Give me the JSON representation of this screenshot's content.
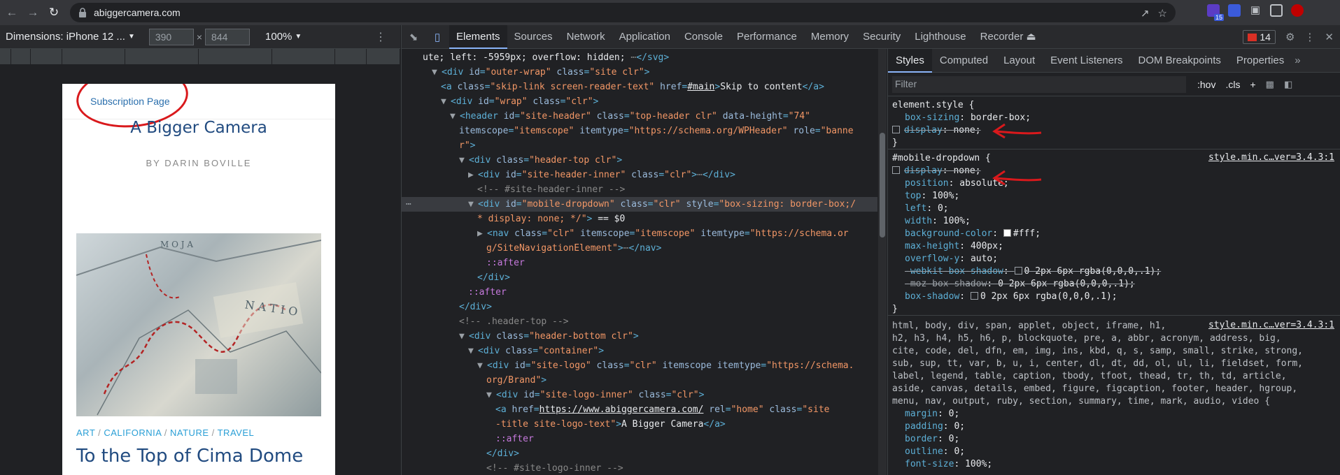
{
  "browser": {
    "url": "abiggercamera.com",
    "ext_badge": "15",
    "extension_colors": [
      "#5b3cc4",
      "#3b5bdb",
      "#bdc1c6",
      "#bdc1c6",
      "#c00000"
    ]
  },
  "device_bar": {
    "dimensions_label": "Dimensions: iPhone 12 ...",
    "width": "390",
    "height": "844",
    "zoom": "100%"
  },
  "page": {
    "subscription_link": "Subscription Page",
    "site_title": "A Bigger Camera",
    "tagline": "BY DARIN BOVILLE",
    "categories": [
      "ART",
      "CALIFORNIA",
      "NATURE",
      "TRAVEL"
    ],
    "category_separator": " / ",
    "post_title": "To the Top of Cima Dome"
  },
  "devtools": {
    "tabs": [
      "Elements",
      "Sources",
      "Network",
      "Application",
      "Console",
      "Performance",
      "Memory",
      "Security",
      "Lighthouse",
      "Recorder ⏏"
    ],
    "issues_count": "14",
    "tree": [
      {
        "segs": [
          [
            "txt",
            "ute; left: -5959px; overflow: hidden; "
          ],
          [
            "cmt",
            "⋯"
          ],
          [
            "tag",
            "</svg>"
          ]
        ],
        "indent": 0
      },
      {
        "segs": [
          [
            "arrow",
            "▼"
          ],
          [
            "tag",
            "<div "
          ],
          [
            "attr",
            "id"
          ],
          [
            "tag",
            "="
          ],
          [
            "val",
            "\"outer-wrap\""
          ],
          [
            "attr",
            " class"
          ],
          [
            "tag",
            "="
          ],
          [
            "val",
            "\"site clr\""
          ],
          [
            "tag",
            ">"
          ]
        ],
        "indent": 1
      },
      {
        "segs": [
          [
            "tag",
            "<a "
          ],
          [
            "attr",
            "class"
          ],
          [
            "tag",
            "="
          ],
          [
            "val",
            "\"skip-link screen-reader-text\""
          ],
          [
            "attr",
            " href"
          ],
          [
            "tag",
            "="
          ],
          [
            "link",
            "#main"
          ],
          [
            "tag",
            ">"
          ],
          [
            "txt",
            "Skip to content"
          ],
          [
            "tag",
            "</a>"
          ]
        ],
        "indent": 2
      },
      {
        "segs": [
          [
            "arrow",
            "▼"
          ],
          [
            "tag",
            "<div "
          ],
          [
            "attr",
            "id"
          ],
          [
            "tag",
            "="
          ],
          [
            "val",
            "\"wrap\""
          ],
          [
            "attr",
            " class"
          ],
          [
            "tag",
            "="
          ],
          [
            "val",
            "\"clr\""
          ],
          [
            "tag",
            ">"
          ]
        ],
        "indent": 2
      },
      {
        "segs": [
          [
            "arrow",
            "▼"
          ],
          [
            "tag",
            "<header "
          ],
          [
            "attr",
            "id"
          ],
          [
            "tag",
            "="
          ],
          [
            "val",
            "\"site-header\""
          ],
          [
            "attr",
            " class"
          ],
          [
            "tag",
            "="
          ],
          [
            "val",
            "\"top-header clr\""
          ],
          [
            "attr",
            " data-height"
          ],
          [
            "tag",
            "="
          ],
          [
            "val",
            "\"74\""
          ]
        ],
        "indent": 3
      },
      {
        "segs": [
          [
            "attr",
            "itemscope"
          ],
          [
            "tag",
            "="
          ],
          [
            "val",
            "\"itemscope\""
          ],
          [
            "attr",
            " itemtype"
          ],
          [
            "tag",
            "="
          ],
          [
            "val",
            "\"https://schema.org/WPHeader\""
          ],
          [
            "attr",
            " role"
          ],
          [
            "tag",
            "="
          ],
          [
            "val",
            "\"banne"
          ]
        ],
        "indent": 4
      },
      {
        "segs": [
          [
            "val",
            "r\""
          ],
          [
            "tag",
            ">"
          ]
        ],
        "indent": 4
      },
      {
        "segs": [
          [
            "arrow",
            "▼"
          ],
          [
            "tag",
            "<div "
          ],
          [
            "attr",
            "class"
          ],
          [
            "tag",
            "="
          ],
          [
            "val",
            "\"header-top clr\""
          ],
          [
            "tag",
            ">"
          ]
        ],
        "indent": 4
      },
      {
        "segs": [
          [
            "arrow",
            "▶"
          ],
          [
            "tag",
            "<div "
          ],
          [
            "attr",
            "id"
          ],
          [
            "tag",
            "="
          ],
          [
            "val",
            "\"site-header-inner\""
          ],
          [
            "attr",
            " class"
          ],
          [
            "tag",
            "="
          ],
          [
            "val",
            "\"clr\""
          ],
          [
            "tag",
            ">"
          ],
          [
            "cmt",
            "⋯"
          ],
          [
            "tag",
            "</div>"
          ]
        ],
        "indent": 5
      },
      {
        "segs": [
          [
            "cmt",
            "<!-- #site-header-inner -->"
          ]
        ],
        "indent": 6
      },
      {
        "segs": [
          [
            "arrow",
            "▼"
          ],
          [
            "tag",
            "<div "
          ],
          [
            "attr",
            "id"
          ],
          [
            "tag",
            "="
          ],
          [
            "val",
            "\"mobile-dropdown\""
          ],
          [
            "attr",
            " class"
          ],
          [
            "tag",
            "="
          ],
          [
            "val",
            "\"clr\""
          ],
          [
            "attr",
            " style"
          ],
          [
            "tag",
            "="
          ],
          [
            "val",
            "\"box-sizing: border-box;/"
          ]
        ],
        "indent": 5,
        "selected": true
      },
      {
        "segs": [
          [
            "val",
            "* display: none; */\""
          ],
          [
            "tag",
            ">"
          ],
          [
            "txt",
            " == $0"
          ]
        ],
        "indent": 6
      },
      {
        "segs": [
          [
            "arrow",
            "▶"
          ],
          [
            "tag",
            "<nav "
          ],
          [
            "attr",
            "class"
          ],
          [
            "tag",
            "="
          ],
          [
            "val",
            "\"clr\""
          ],
          [
            "attr",
            " itemscope"
          ],
          [
            "tag",
            "="
          ],
          [
            "val",
            "\"itemscope\""
          ],
          [
            "attr",
            " itemtype"
          ],
          [
            "tag",
            "="
          ],
          [
            "val",
            "\"https://schema.or"
          ]
        ],
        "indent": 6
      },
      {
        "segs": [
          [
            "val",
            "g/SiteNavigationElement\""
          ],
          [
            "tag",
            ">"
          ],
          [
            "cmt",
            "⋯"
          ],
          [
            "tag",
            "</nav>"
          ]
        ],
        "indent": 7
      },
      {
        "segs": [
          [
            "pseudo",
            "::after"
          ]
        ],
        "indent": 7
      },
      {
        "segs": [
          [
            "tag",
            "</div>"
          ]
        ],
        "indent": 6
      },
      {
        "segs": [
          [
            "pseudo",
            "::after"
          ]
        ],
        "indent": 5
      },
      {
        "segs": [
          [
            "tag",
            "</div>"
          ]
        ],
        "indent": 4
      },
      {
        "segs": [
          [
            "cmt",
            "<!-- .header-top -->"
          ]
        ],
        "indent": 4
      },
      {
        "segs": [
          [
            "arrow",
            "▼"
          ],
          [
            "tag",
            "<div "
          ],
          [
            "attr",
            "class"
          ],
          [
            "tag",
            "="
          ],
          [
            "val",
            "\"header-bottom clr\""
          ],
          [
            "tag",
            ">"
          ]
        ],
        "indent": 4
      },
      {
        "segs": [
          [
            "arrow",
            "▼"
          ],
          [
            "tag",
            "<div "
          ],
          [
            "attr",
            "class"
          ],
          [
            "tag",
            "="
          ],
          [
            "val",
            "\"container\""
          ],
          [
            "tag",
            ">"
          ]
        ],
        "indent": 5
      },
      {
        "segs": [
          [
            "arrow",
            "▼"
          ],
          [
            "tag",
            "<div "
          ],
          [
            "attr",
            "id"
          ],
          [
            "tag",
            "="
          ],
          [
            "val",
            "\"site-logo\""
          ],
          [
            "attr",
            " class"
          ],
          [
            "tag",
            "="
          ],
          [
            "val",
            "\"clr\""
          ],
          [
            "attr",
            " itemscope"
          ],
          [
            "attr",
            " itemtype"
          ],
          [
            "tag",
            "="
          ],
          [
            "val",
            "\"https://schema."
          ]
        ],
        "indent": 6
      },
      {
        "segs": [
          [
            "val",
            "org/Brand\""
          ],
          [
            "tag",
            ">"
          ]
        ],
        "indent": 7
      },
      {
        "segs": [
          [
            "arrow",
            "▼"
          ],
          [
            "tag",
            "<div "
          ],
          [
            "attr",
            "id"
          ],
          [
            "tag",
            "="
          ],
          [
            "val",
            "\"site-logo-inner\""
          ],
          [
            "attr",
            " class"
          ],
          [
            "tag",
            "="
          ],
          [
            "val",
            "\"clr\""
          ],
          [
            "tag",
            ">"
          ]
        ],
        "indent": 7
      },
      {
        "segs": [
          [
            "tag",
            "<a "
          ],
          [
            "attr",
            "href"
          ],
          [
            "tag",
            "="
          ],
          [
            "link",
            "https://www.abiggercamera.com/"
          ],
          [
            "attr",
            " rel"
          ],
          [
            "tag",
            "="
          ],
          [
            "val",
            "\"home\""
          ],
          [
            "attr",
            " class"
          ],
          [
            "tag",
            "="
          ],
          [
            "val",
            "\"site"
          ]
        ],
        "indent": 8
      },
      {
        "segs": [
          [
            "val",
            "-title site-logo-text\""
          ],
          [
            "tag",
            ">"
          ],
          [
            "txt",
            "A Bigger Camera"
          ],
          [
            "tag",
            "</a>"
          ]
        ],
        "indent": 8
      },
      {
        "segs": [
          [
            "pseudo",
            "::after"
          ]
        ],
        "indent": 8
      },
      {
        "segs": [
          [
            "tag",
            "</div>"
          ]
        ],
        "indent": 7
      },
      {
        "segs": [
          [
            "cmt",
            "<!-- #site-logo-inner -->"
          ]
        ],
        "indent": 7
      }
    ],
    "styles_tabs": [
      "Styles",
      "Computed",
      "Layout",
      "Event Listeners",
      "DOM Breakpoints",
      "Properties"
    ],
    "filter_placeholder": "Filter",
    "filter_tools": [
      ":hov",
      ".cls",
      "+"
    ],
    "element_style": {
      "selector": "element.style {",
      "props": [
        {
          "name": "box-sizing",
          "value": "border-box;",
          "checkbox": false,
          "struck": false
        },
        {
          "name": "display",
          "value": "none;",
          "checkbox": true,
          "struck": true
        }
      ]
    },
    "mobile_dropdown": {
      "selector": "#mobile-dropdown {",
      "source": "style.min.c…ver=3.4.3:1",
      "props": [
        {
          "name": "display",
          "value": "none;",
          "checkbox": true,
          "struck": true
        },
        {
          "name": "position",
          "value": "absolute;"
        },
        {
          "name": "top",
          "value": "100%;"
        },
        {
          "name": "left",
          "value": "0;"
        },
        {
          "name": "width",
          "value": "100%;"
        },
        {
          "name": "background-color",
          "value": "#fff;",
          "swatch": "#fff"
        },
        {
          "name": "max-height",
          "value": "400px;"
        },
        {
          "name": "overflow-y",
          "value": "auto;"
        },
        {
          "name": "-webkit-box-shadow",
          "value": "0 2px 6px rgba(0,0,0,.1);",
          "struck": true,
          "shadow": true
        },
        {
          "name": "-moz-box-shadow",
          "value": "0 2px 6px rgba(0,0,0,.1);",
          "struck": true,
          "dim": true
        },
        {
          "name": "box-shadow",
          "value": "0 2px 6px rgba(0,0,0,.1);",
          "shadow": true
        }
      ]
    },
    "reset_rule": {
      "source": "style.min.c…ver=3.4.3:1",
      "selector_lines": [
        "html, body, div, span, applet, object, iframe, h1,",
        "h2, h3, h4, h5, h6, p, blockquote, pre, a, abbr, acronym, address, big,",
        "cite, code, del, dfn, em, img, ins, kbd, q, s, samp, small, strike, strong,",
        "sub, sup, tt, var, b, u, i, center, dl, dt, dd, ol, ul, li, fieldset, form,",
        "label, legend, table, caption, tbody, tfoot, thead, tr, th, td, article,",
        "aside, canvas, details, embed, figure, figcaption, footer, header, hgroup,",
        "menu, nav, output, ruby, section, summary, time, mark, audio, video {"
      ],
      "props": [
        {
          "name": "margin",
          "value": "0;"
        },
        {
          "name": "padding",
          "value": "0;"
        },
        {
          "name": "border",
          "value": "0;"
        },
        {
          "name": "outline",
          "value": "0;"
        },
        {
          "name": "font-size",
          "value": "100%;"
        }
      ]
    }
  }
}
